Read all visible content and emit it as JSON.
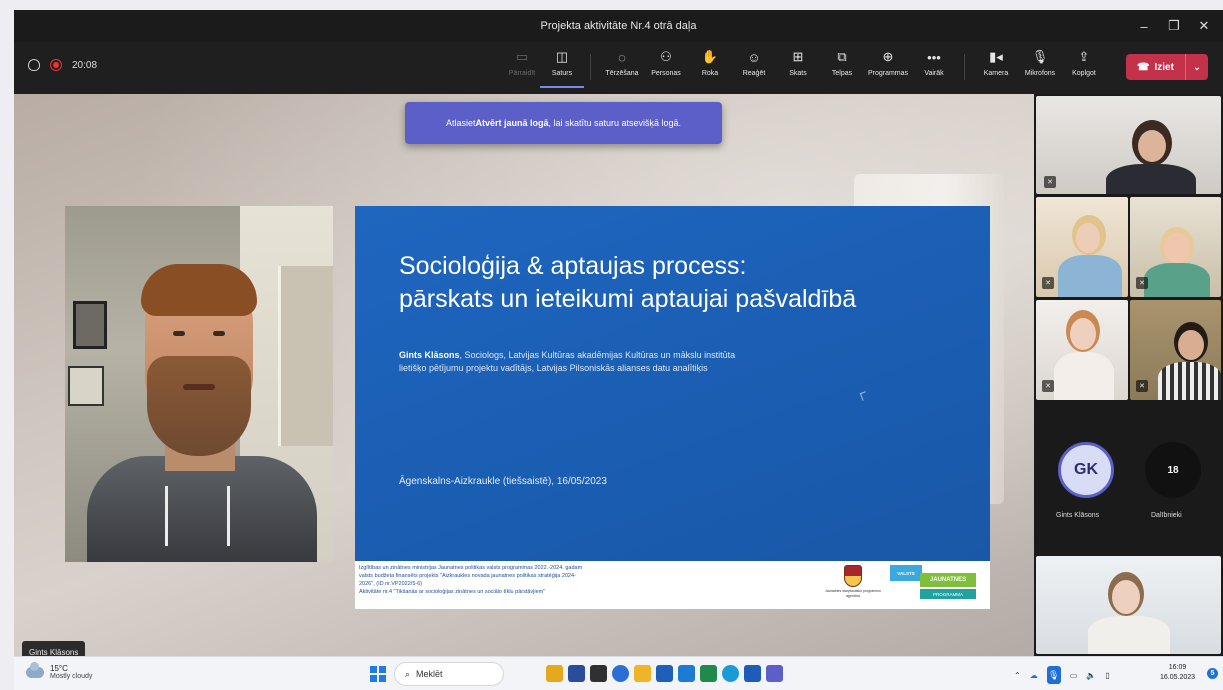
{
  "window": {
    "title": "Projekta aktivitāte Nr.4 otrā daļa"
  },
  "recording": {
    "timer": "20:08"
  },
  "toolbar": {
    "buttons": [
      {
        "label": "Pārraidīt",
        "icon": "cast-icon"
      },
      {
        "label": "Saturs",
        "icon": "share-content-icon"
      },
      {
        "label": "Tērzēšana",
        "icon": "chat-icon"
      },
      {
        "label": "Personas",
        "icon": "people-icon"
      },
      {
        "label": "Roka",
        "icon": "raise-hand-icon"
      },
      {
        "label": "Reaģēt",
        "icon": "react-icon"
      },
      {
        "label": "Skats",
        "icon": "view-icon"
      },
      {
        "label": "Telpas",
        "icon": "rooms-icon"
      },
      {
        "label": "Programmas",
        "icon": "apps-icon"
      },
      {
        "label": "Vairāk",
        "icon": "more-icon"
      },
      {
        "label": "Kamera",
        "icon": "camera-icon"
      },
      {
        "label": "Mikrofons",
        "icon": "microphone-icon"
      },
      {
        "label": "Koplgot",
        "icon": "share-icon"
      }
    ],
    "leave_label": "Iziet",
    "leave_color": "#c4314b"
  },
  "tooltip": {
    "prefix": "Atlasiet ",
    "bold": "Atvērt jaunā logā",
    "suffix": ", lai skatītu saturu atsevišķā logā."
  },
  "slide": {
    "title_line1": "Socioloģija & aptaujas process:",
    "title_line2": "pārskats un ieteikumi aptaujai pašvaldībā",
    "author_name": "Gints Klāsons",
    "author_desc_line1": ", Sociologs, Latvijas Kultūras akadēmijas Kultūras un mākslu institūta",
    "author_desc_line2": "lietišķo pētījumu projektu vadītājs, Latvijas Pilsoniskās alianses datu analītiķis",
    "footer": "Āgenskalns-Aizkraukle (tiešsaistē), 16/05/2023",
    "band_line1": "Izglītības un zinātnes ministrijas Jaunatnes politikas valsts programmas 2022.-2024. gadam",
    "band_line2": "valsts budžeta finansēts projekts \"Aizkraukles novada jaunatnes politikas stratēģija 2024-",
    "band_line3": "2026\", (ID nr.VP2022/5-6)",
    "band_line4": "Aktivitāte nr.4 \"Tikšanās ar socioloģijas zinātnes un sociālo tīklu pārstāvjiem\"",
    "crest_caption": "Jaunatnes starptautisko programmu aģentūra",
    "logo_valsts": "VALSTS",
    "logo_jaunatnes": "JAUNATNES",
    "logo_programma": "PROGRAMMA",
    "bg_color": "#1a5db1"
  },
  "speaker": {
    "name": "Gints Klāsons"
  },
  "gallery": {
    "avatar_initials": "GK",
    "avatar_name": "Gints Klāsons",
    "participants_count": "18",
    "participants_label": "Dalībnieki"
  },
  "taskbar": {
    "temperature": "15°C",
    "weather": "Mostly cloudy",
    "search_label": "Meklēt",
    "time": "16:09",
    "date": "16.05.2023",
    "notifications": "5"
  }
}
